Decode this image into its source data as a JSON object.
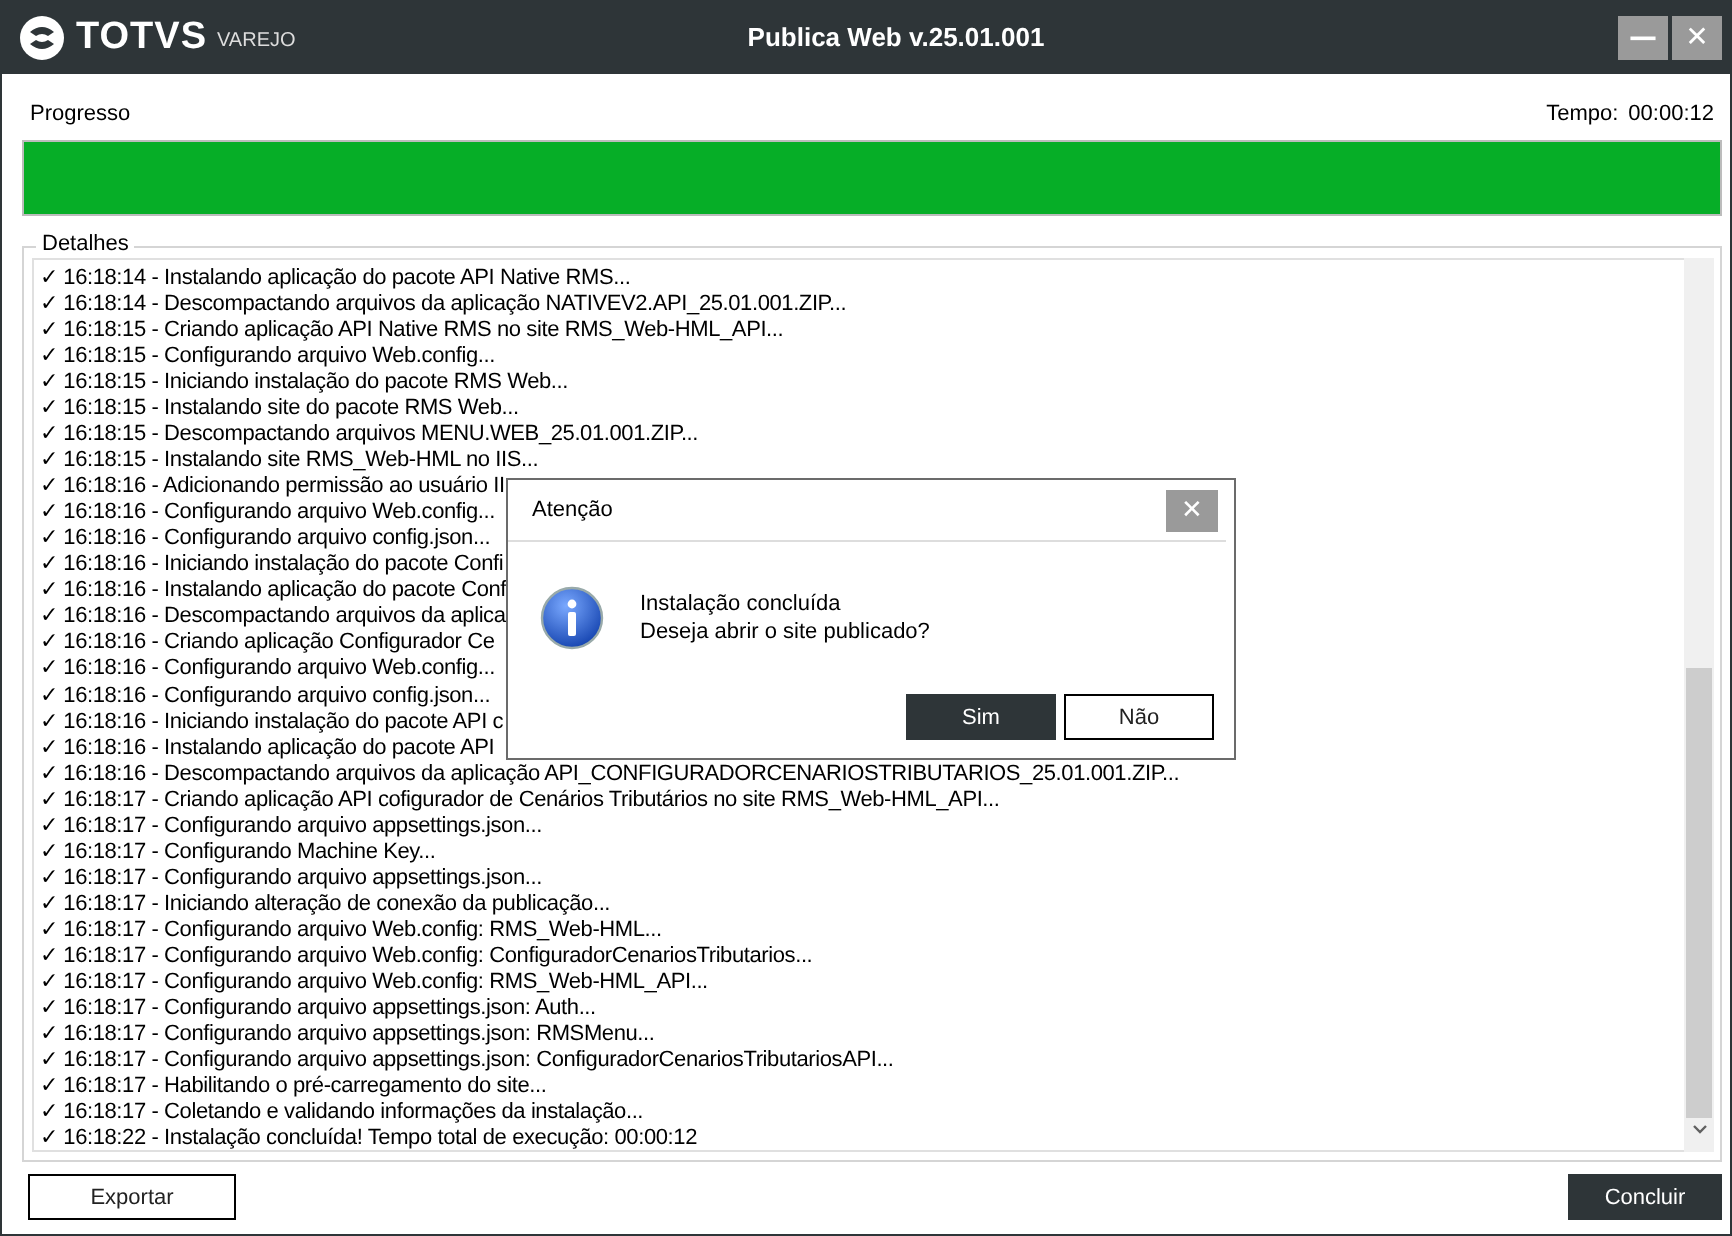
{
  "window": {
    "brand": "TOTVS",
    "brand_sub": "VAREJO",
    "title": "Publica Web v.25.01.001",
    "controls": [
      "—",
      "✕"
    ]
  },
  "progress": {
    "label": "Progresso",
    "time_label": "Tempo:",
    "time": "00:00:12",
    "level": 1
  },
  "details": {
    "title": "Detalhes",
    "lines": [
      "✓ 16:18:14 - Instalando aplicação do pacote API Native RMS...",
      "✓ 16:18:14 - Descompactando arquivos da aplicação NATIVEV2.API_25.01.001.ZIP...",
      "✓ 16:18:15 - Criando aplicação API Native RMS no site RMS_Web-HML_API...",
      "✓ 16:18:15 - Configurando arquivo Web.config...",
      "✓ 16:18:15 - Iniciando instalação do pacote RMS Web...",
      "✓ 16:18:15 - Instalando site do pacote RMS Web...",
      "✓ 16:18:15 - Descompactando arquivos MENU.WEB_25.01.001.ZIP...",
      "✓ 16:18:15 - Instalando site RMS_Web-HML no IIS...",
      "✓ 16:18:16 - Adicionando permissão ao usuário II",
      "✓ 16:18:16 - Configurando arquivo Web.config...",
      "✓ 16:18:16 - Configurando arquivo config.json...",
      "✓ 16:18:16 - Iniciando instalação do pacote Confi",
      "✓ 16:18:16 - Instalando aplicação do pacote Conf",
      "✓ 16:18:16 - Descompactando arquivos da aplica",
      "✓ 16:18:16 - Criando aplicação Configurador Ce",
      "✓ 16:18:16 - Configurando arquivo Web.config...",
      "✓ 16:18:16 - Configurando arquivo config.json...",
      "✓ 16:18:16 - Iniciando instalação do pacote API c",
      "✓ 16:18:16 - Instalando aplicação do pacote API",
      "✓ 16:18:16 - Descompactando arquivos da aplicação API_CONFIGURADORCENARIOSTRIBUTARIOS_25.01.001.ZIP...",
      "✓ 16:18:17 - Criando aplicação API cofigurador de Cenários Tributários no site RMS_Web-HML_API...",
      "✓ 16:18:17 - Configurando arquivo appsettings.json...",
      "✓ 16:18:17 - Configurando Machine Key...",
      "✓ 16:18:17 - Configurando arquivo appsettings.json...",
      "✓ 16:18:17 - Iniciando alteração de conexão da publicação...",
      "✓ 16:18:17 - Configurando arquivo Web.config: RMS_Web-HML...",
      "✓ 16:18:17 - Configurando arquivo Web.config: ConfiguradorCenariosTributarios...",
      "✓ 16:18:17 - Configurando arquivo Web.config: RMS_Web-HML_API...",
      "✓ 16:18:17 - Configurando arquivo appsettings.json: Auth...",
      "✓ 16:18:17 - Configurando arquivo appsettings.json: RMSMenu...",
      "✓ 16:18:17 - Configurando arquivo appsettings.json: ConfiguradorCenariosTributariosAPI...",
      "✓ 16:18:17 - Habilitando o pré-carregamento do site...",
      "✓ 16:18:17 - Coletando e validando informações da instalação...",
      "✓ 16:18:22 - Instalação concluída! Tempo total de execução: 00:00:12"
    ]
  },
  "buttons": [
    {
      "label": "Exportar",
      "kind": "outline"
    },
    {
      "label": "Concluir",
      "kind": "dark"
    }
  ],
  "dialog": {
    "title": "Atenção",
    "close": "✕",
    "message": [
      "Instalação concluída",
      "Deseja abrir o site publicado?"
    ],
    "buttons": [
      {
        "label": "Sim",
        "kind": "dark"
      },
      {
        "label": "Não",
        "kind": "outline"
      }
    ]
  }
}
